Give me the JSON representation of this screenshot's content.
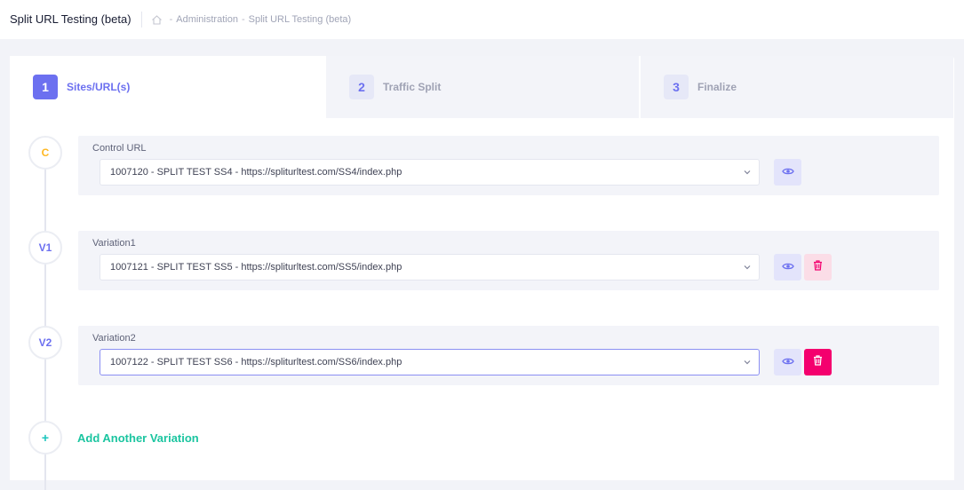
{
  "header": {
    "title": "Split URL Testing (beta)",
    "breadcrumb": [
      "Administration",
      "Split URL Testing (beta)"
    ],
    "separator": "-"
  },
  "steps": [
    {
      "number": "1",
      "label": "Sites/URL(s)",
      "active": true
    },
    {
      "number": "2",
      "label": "Traffic Split",
      "active": false
    },
    {
      "number": "3",
      "label": "Finalize",
      "active": false
    }
  ],
  "urls": [
    {
      "node": "C",
      "label": "Control URL",
      "value": "1007120 - SPLIT TEST SS4 - https://spliturltest.com/SS4/index.php"
    },
    {
      "node": "V1",
      "label": "Variation1",
      "value": "1007121 - SPLIT TEST SS5 - https://spliturltest.com/SS5/index.php"
    },
    {
      "node": "V2",
      "label": "Variation2",
      "value": "1007122 - SPLIT TEST SS6 - https://spliturltest.com/SS6/index.php"
    }
  ],
  "add_variation": {
    "icon": "+",
    "label": "Add Another Variation"
  },
  "colors": {
    "accent": "#6c70f0",
    "control": "#ffb822",
    "add": "#1bc5a0",
    "delete_active": "#f4006e",
    "delete_light": "#fbdde7"
  },
  "icons": {
    "view": "eye-icon",
    "delete": "trash-icon",
    "dropdown": "chevron-down-icon",
    "home": "home-icon"
  }
}
